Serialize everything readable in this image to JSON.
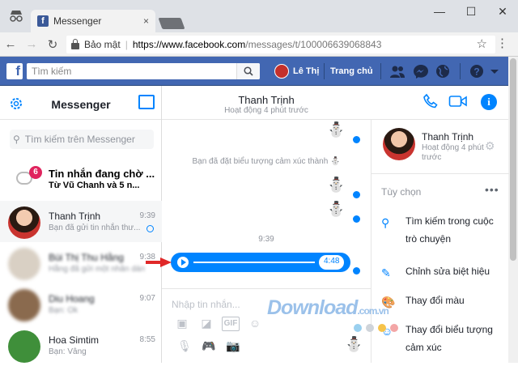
{
  "browser": {
    "tab_title": "Messenger",
    "tab_close": "×",
    "window_controls": [
      "—",
      "☐",
      "✕"
    ],
    "security_label": "Bảo mật",
    "url_host": "https://www.facebook.com",
    "url_path": "/messages/t/100006639068843"
  },
  "fb": {
    "logo": "f",
    "search_placeholder": "Tìm kiếm",
    "user_name": "Lê Thị",
    "home_label": "Trang chủ"
  },
  "sidebar": {
    "title": "Messenger",
    "search_placeholder": "Tìm kiếm trên Messenger",
    "pending": {
      "badge": "6",
      "title": "Tin nhắn đang chờ ...",
      "subtitle": "Từ Vũ Chanh và 5 n..."
    },
    "conversations": [
      {
        "name": "Thanh Trịnh",
        "preview": "Bạn đã gửi tin nhắn thư...",
        "time": "9:39",
        "active": true
      },
      {
        "name": "Bùi Thị Thu Hằng",
        "preview": "Hằng đã gửi một nhãn dán",
        "time": "9:38",
        "active": false
      },
      {
        "name": "Diu Hoang",
        "preview": "Bạn: Ok",
        "time": "9:07",
        "active": false
      },
      {
        "name": "Hoa Simtim",
        "preview": "Bạn: Vâng",
        "time": "8:55",
        "active": false
      }
    ]
  },
  "chat": {
    "contact_name": "Thanh Trịnh",
    "status": "Hoạt động 4 phút trước",
    "system_message": "Bạn đã đặt biểu tượng cảm xúc thành",
    "time_divider": "9:39",
    "audio_duration": "4:48",
    "sticker": "⛄",
    "composer_placeholder": "Nhập tin nhắn...",
    "gif_label": "GIF"
  },
  "profile": {
    "name": "Thanh Trịnh",
    "status": "Hoạt động 4 phút trước",
    "options_label": "Tùy chọn",
    "options": [
      {
        "icon": "search-icon",
        "label": "Tìm kiếm trong cuộc trò chuyện"
      },
      {
        "icon": "pencil-icon",
        "label": "Chỉnh sửa biệt hiệu"
      },
      {
        "icon": "palette-icon",
        "label": "Thay đổi màu"
      },
      {
        "icon": "emoji-icon",
        "label": "Thay đổi biểu tượng cảm xúc"
      }
    ]
  },
  "watermark": {
    "text": "Download",
    "suffix": ".com.vn"
  },
  "colors": {
    "fb_blue": "#4267b2",
    "messenger_blue": "#0084ff",
    "arrow_red": "#e02828"
  }
}
